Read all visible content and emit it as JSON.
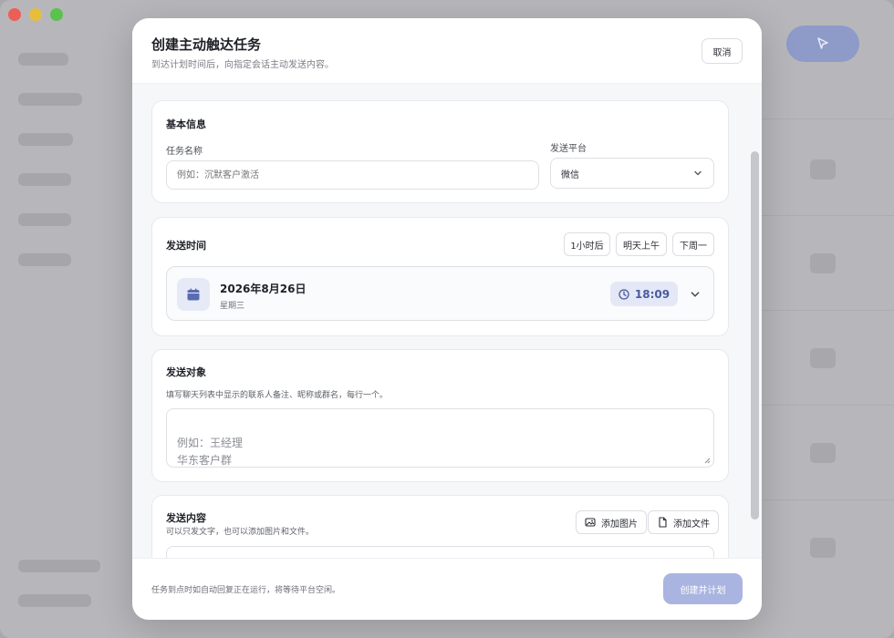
{
  "window": {
    "traffic_lights": [
      "close",
      "minimize",
      "zoom"
    ],
    "colors": {
      "close": "#ec5f57",
      "minimize": "#e6be3c",
      "zoom": "#5cc14f"
    }
  },
  "modal": {
    "title": "创建主动触达任务",
    "subtitle": "到达计划时间后，向指定会话主动发送内容。",
    "cancel_label": "取消"
  },
  "basic_info": {
    "title": "基本信息",
    "task_name_label": "任务名称",
    "task_name_placeholder": "例如：沉默客户激活",
    "platform_label": "发送平台",
    "platform_value": "微信"
  },
  "send_time": {
    "title": "发送时间",
    "quick_chips": [
      "1小时后",
      "明天上午",
      "下周一"
    ],
    "date": "2026年8月26日",
    "weekday": "星期三",
    "time": "18:09"
  },
  "recipients": {
    "title": "发送对象",
    "hint": "填写聊天列表中显示的联系人备注、昵称或群名，每行一个。",
    "placeholder": "例如：王经理\n华东客户群"
  },
  "content": {
    "title": "发送内容",
    "hint": "可以只发文字，也可以添加图片和文件。",
    "add_image_label": "添加图片",
    "add_file_label": "添加文件"
  },
  "footer": {
    "note": "任务到点时如自动回复正在运行，将等待平台空闲。",
    "create_label": "创建并计划"
  },
  "colors": {
    "accent": "#4a5a9e",
    "accent_light": "#e4e8f6",
    "primary_disabled": "#a9b5e0"
  }
}
